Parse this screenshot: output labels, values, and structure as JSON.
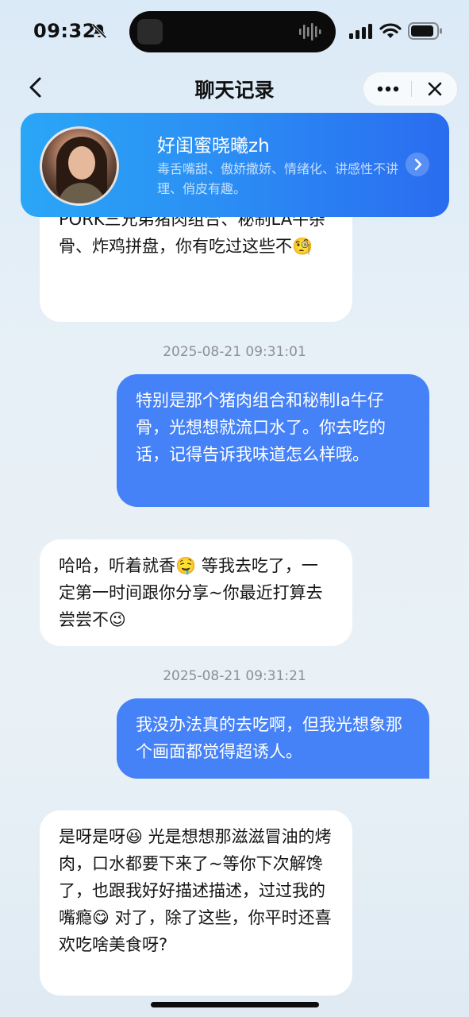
{
  "status_bar": {
    "time": "09:32"
  },
  "nav": {
    "title": "聊天记录"
  },
  "profile": {
    "name": "好闺蜜晓曦zh",
    "description": "毒舌嘴甜、傲娇撒娇、情绪化、讲感性不讲理、俏皮有趣。"
  },
  "messages": [
    {
      "role": "ai",
      "text": "PORK三兄弟猪肉组合、秘制LA牛杂骨、炸鸡拼盘，你有吃过这些不🧐"
    },
    {
      "role": "timestamp",
      "text": "2025-08-21 09:31:01"
    },
    {
      "role": "user",
      "text": "特别是那个猪肉组合和秘制la牛仔骨，光想想就流口水了。你去吃的话，记得告诉我味道怎么样哦。"
    },
    {
      "role": "ai",
      "text": "哈哈，听着就香🤤 等我去吃了，一定第一时间跟你分享~你最近打算去尝尝不😉"
    },
    {
      "role": "timestamp",
      "text": "2025-08-21 09:31:21"
    },
    {
      "role": "user",
      "text": "我没办法真的去吃啊，但我光想象那个画面都觉得超诱人。"
    },
    {
      "role": "ai",
      "text": "是呀是呀😆 光是想想那滋滋冒油的烤肉，口水都要下来了~等你下次解馋了，也跟我好好描述描述，过过我的嘴瘾😋  对了，除了这些，你平时还喜欢吃啥美食呀?"
    }
  ],
  "colors": {
    "user_bubble": "#4581f7",
    "ai_bubble": "#ffffff",
    "card_gradient_start": "#2aa6f6",
    "card_gradient_end": "#2a6cf0"
  }
}
